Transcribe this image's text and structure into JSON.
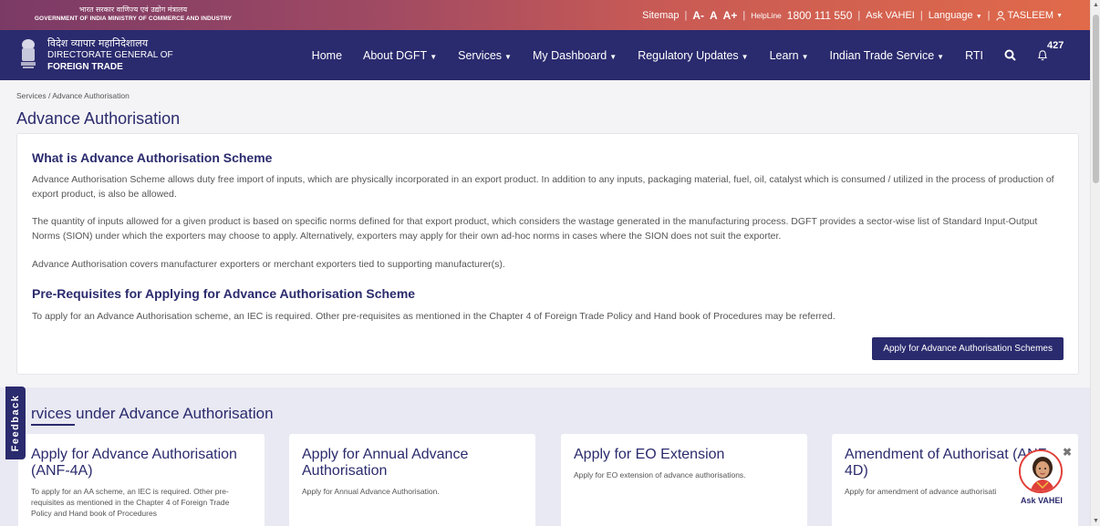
{
  "top_strip": {
    "gov_hindi": "भारत सरकार  वाणिज्य एवं उद्योग मंत्रालय",
    "gov_english": "GOVERNMENT OF INDIA   MINISTRY OF COMMERCE AND INDUSTRY",
    "sitemap": "Sitemap",
    "font_minus": "A-",
    "font_normal": "A",
    "font_plus": "A+",
    "helpline_label": "HelpLine",
    "helpline_number": "1800 111 550",
    "ask_vahei": "Ask VAHEI",
    "language": "Language",
    "user": "TASLEEM"
  },
  "header": {
    "brand_hindi": "विदेश व्यापार महानिदेशालय",
    "brand_line2": "DIRECTORATE GENERAL OF",
    "brand_line3": "FOREIGN TRADE",
    "nav": [
      {
        "label": "Home",
        "dropdown": false
      },
      {
        "label": "About DGFT",
        "dropdown": true
      },
      {
        "label": "Services",
        "dropdown": true
      },
      {
        "label": "My Dashboard",
        "dropdown": true
      },
      {
        "label": "Regulatory Updates",
        "dropdown": true
      },
      {
        "label": "Learn",
        "dropdown": true
      },
      {
        "label": "Indian Trade Service",
        "dropdown": true
      },
      {
        "label": "RTI",
        "dropdown": false
      }
    ],
    "notification_count": "427"
  },
  "breadcrumb": "Services  /  Advance Authorisation",
  "page_title": "Advance Authorisation",
  "info_card": {
    "heading1": "What is Advance Authorisation Scheme",
    "para1": "Advance Authorisation Scheme allows duty free import of inputs, which are physically incorporated in an export product. In addition to any inputs, packaging material, fuel, oil, catalyst which is consumed / utilized in the process of production of export product, is also be allowed.",
    "para2": "The quantity of inputs allowed for a given product is based on specific norms defined for that export product, which considers the wastage generated in the manufacturing process. DGFT provides a sector-wise list of Standard Input-Output Norms (SION) under which the exporters may choose to apply. Alternatively, exporters may apply for their own ad-hoc norms in cases where the SION does not suit the exporter.",
    "para3": "Advance Authorisation covers manufacturer exporters or merchant exporters tied to supporting manufacturer(s).",
    "heading2": "Pre-Requisites for Applying for Advance Authorisation Scheme",
    "para4": "To apply for an Advance Authorisation scheme, an IEC is required. Other pre-requisites as mentioned in the Chapter 4 of Foreign Trade Policy and Hand book of Procedures may be referred.",
    "apply_button": "Apply for Advance Authorisation Schemes"
  },
  "services_section": {
    "title": "rvices under Advance Authorisation",
    "cards": [
      {
        "title": "Apply for Advance Authorisation (ANF-4A)",
        "desc": "To apply for an AA scheme, an IEC is required. Other pre-requisites as mentioned in the Chapter 4 of Foreign Trade Policy and Hand book of Procedures"
      },
      {
        "title": "Apply for Annual Advance Authorisation",
        "desc": "Apply for Annual Advance Authorisation."
      },
      {
        "title": "Apply for EO Extension",
        "desc": "Apply for EO extension of advance authorisations."
      },
      {
        "title": "Amendment of Authorisat (ANF-4D)",
        "desc": "Apply for amendment of advance authorisati"
      }
    ]
  },
  "feedback_tab": "Feedback",
  "vahei_widget": {
    "label": "Ask VAHEI",
    "close": "✖"
  },
  "colors": {
    "navy": "#2a2a6e",
    "title_blue": "#2b2b6e",
    "strip_start": "#7b3a66",
    "strip_end": "#e06a4a"
  }
}
